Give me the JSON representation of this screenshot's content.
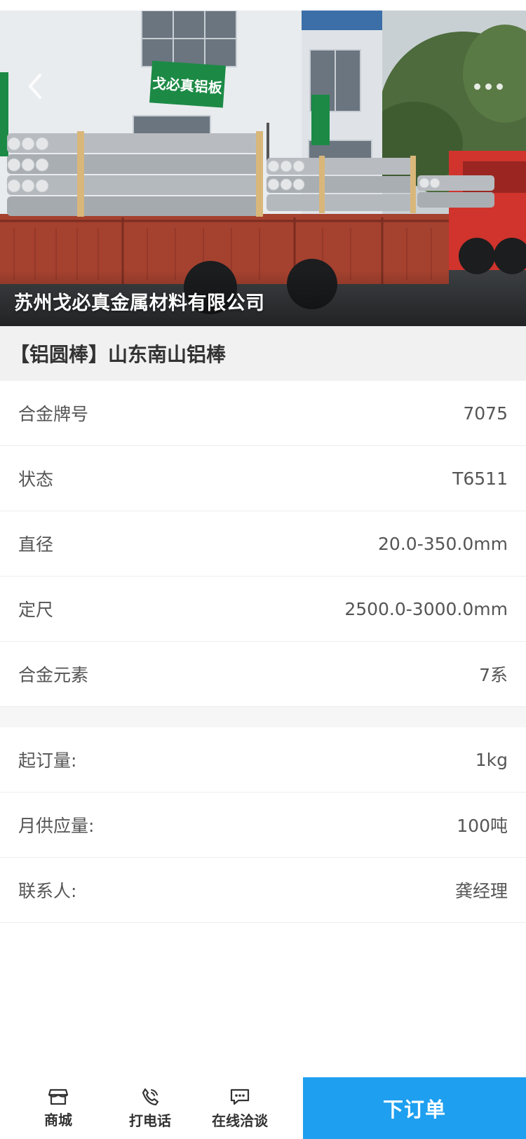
{
  "hero": {
    "company": "苏州戈必真金属材料有限公司",
    "sign_text": "戈必真铝板",
    "side_sign_text": "戈必真铝板",
    "back_icon": "chevron-left-icon",
    "more_icon": "more-dots-icon"
  },
  "product": {
    "title": "【铝圆棒】山东南山铝棒"
  },
  "specs": [
    {
      "label": "合金牌号",
      "value": "7075"
    },
    {
      "label": "状态",
      "value": "T6511"
    },
    {
      "label": "直径",
      "value": "20.0-350.0mm"
    },
    {
      "label": "定尺",
      "value": "2500.0-3000.0mm"
    },
    {
      "label": "合金元素",
      "value": "7系"
    }
  ],
  "terms": [
    {
      "label": "起订量:",
      "value": "1kg"
    },
    {
      "label": "月供应量:",
      "value": "100吨"
    },
    {
      "label": "联系人:",
      "value": "龚经理"
    }
  ],
  "bottom_bar": {
    "shop": {
      "label": "商城",
      "icon": "store-icon"
    },
    "call": {
      "label": "打电话",
      "icon": "phone-icon"
    },
    "chat": {
      "label": "在线洽谈",
      "icon": "chat-icon"
    },
    "order": {
      "label": "下订单"
    }
  },
  "colors": {
    "accent": "#1e9ff0",
    "title_bg": "#f1f1f1",
    "sign_green": "#1c8a45",
    "truck_red": "#a5412f"
  }
}
